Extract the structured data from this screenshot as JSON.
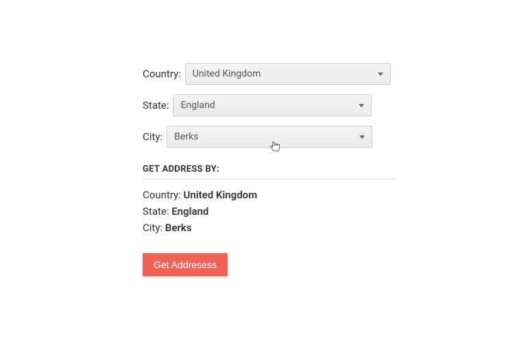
{
  "form": {
    "country": {
      "label": "Country:",
      "value": "United Kingdom"
    },
    "state": {
      "label": "State:",
      "value": "England"
    },
    "city": {
      "label": "City:",
      "value": "Berks"
    }
  },
  "section_title": "GET ADDRESS BY:",
  "summary": {
    "country": {
      "label": "Country:",
      "value": "United Kingdom"
    },
    "state": {
      "label": "State:",
      "value": "England"
    },
    "city": {
      "label": "City:",
      "value": "Berks"
    }
  },
  "button_label": "Get Addresess"
}
